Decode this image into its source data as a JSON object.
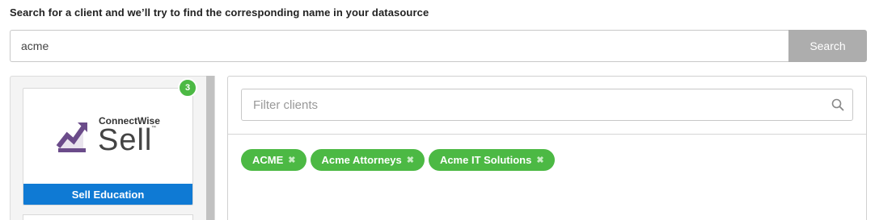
{
  "heading": "Search for a client and we’ll try to find the corresponding name in your datasource",
  "search": {
    "value": "acme",
    "button_label": "Search"
  },
  "integration": {
    "brand": "ConnectWise",
    "product": "Sell",
    "trademark": "™",
    "footer_label": "Sell Education",
    "match_count": "3",
    "footer_color": "#0f7ad4"
  },
  "filter": {
    "placeholder": "Filter clients",
    "icon": "search-icon"
  },
  "tags": [
    {
      "label": "ACME",
      "remove_icon": "✖"
    },
    {
      "label": "Acme Attorneys",
      "remove_icon": "✖"
    },
    {
      "label": "Acme IT Solutions",
      "remove_icon": "✖"
    }
  ],
  "colors": {
    "accent_green": "#4cb944",
    "button_gray": "#adadad",
    "logo_purple": "#6b4c8a"
  }
}
